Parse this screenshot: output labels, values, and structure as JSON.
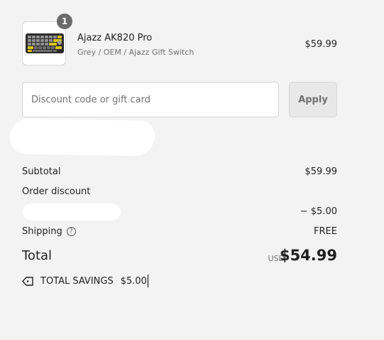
{
  "line_item": {
    "quantity": "1",
    "name": "Ajazz AK820 Pro",
    "variant": "Grey / OEM / Ajazz Gift Switch",
    "price": "$59.99",
    "thumbnail_icon": "keyboard-product-image"
  },
  "discount": {
    "placeholder": "Discount code or gift card",
    "value": "",
    "apply_label": "Apply"
  },
  "summary": {
    "subtotal_label": "Subtotal",
    "subtotal_value": "$59.99",
    "order_discount_label": "Order discount",
    "discount_value": "− $5.00",
    "shipping_label": "Shipping",
    "shipping_value": "FREE",
    "total_label": "Total",
    "currency": "USD",
    "total_value": "$54.99",
    "savings_label": "TOTAL SAVINGS",
    "savings_value": "$5.00"
  },
  "colors": {
    "background": "#f3f3f3",
    "muted_text": "#707070",
    "badge": "#6b6b6b"
  }
}
